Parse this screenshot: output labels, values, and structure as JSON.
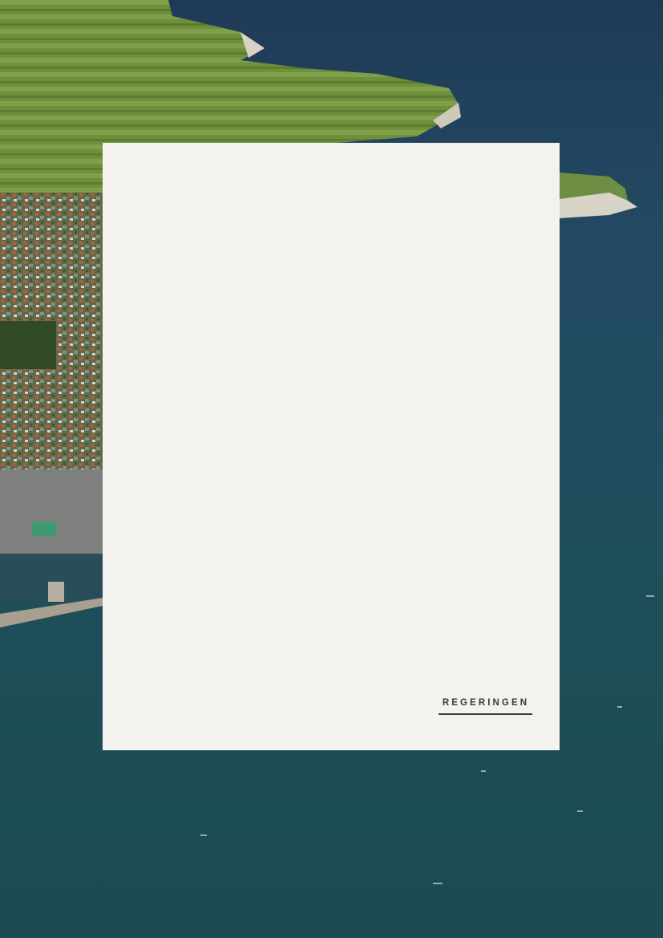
{
  "cover": {
    "background_image": "aerial-coastline-photo",
    "panel_color": "#f3f2ee",
    "wordmark": "REGERINGEN",
    "wordmark_color": "#3a3a38"
  }
}
